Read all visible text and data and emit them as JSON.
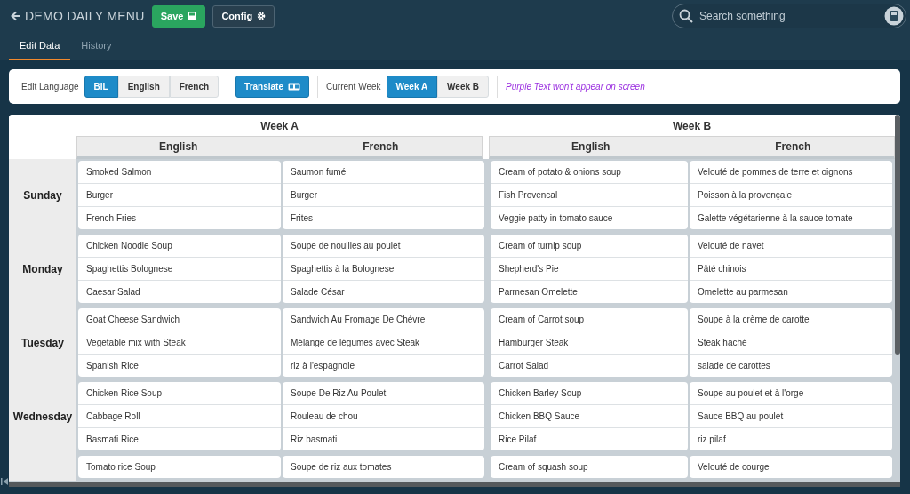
{
  "header": {
    "title": "DEMO DAILY MENU",
    "buttons": [
      {
        "label": "Save",
        "kind": "save"
      },
      {
        "label": "Config",
        "kind": "config"
      }
    ],
    "search": {
      "placeholder": "Search something"
    }
  },
  "tabs": [
    {
      "label": "Edit Data",
      "selected": true
    },
    {
      "label": "History",
      "selected": false
    }
  ],
  "toolbar": {
    "language_label": "Edit Language",
    "languages": [
      {
        "label": "BIL",
        "selected": true
      },
      {
        "label": "English",
        "selected": false
      },
      {
        "label": "French",
        "selected": false
      }
    ],
    "translate": "Translate",
    "week_label": "Current Week",
    "weeks": [
      {
        "label": "Week A",
        "selected": true
      },
      {
        "label": "Week B",
        "selected": false
      }
    ],
    "note": "Purple Text won't appear on screen"
  },
  "table": {
    "weeks": [
      {
        "title": "Week A",
        "columns": [
          "English",
          "French"
        ]
      },
      {
        "title": "Week B",
        "columns": [
          "English",
          "French"
        ]
      }
    ],
    "days": [
      {
        "day": "Sunday",
        "menus": [
          [
            "Smoked Salmon",
            "Burger",
            "French Fries"
          ],
          [
            "Saumon fumé",
            "Burger",
            "Frites"
          ],
          [
            "Cream of potato & onions soup",
            "Fish Provencal",
            "Veggie patty in tomato sauce"
          ],
          [
            "Velouté de pommes de terre et oignons",
            "Poisson à la provençale",
            "Galette végétarienne à la sauce tomate"
          ]
        ]
      },
      {
        "day": "Monday",
        "menus": [
          [
            "Chicken Noodle Soup",
            "Spaghettis Bolognese",
            "Caesar Salad"
          ],
          [
            "Soupe de nouilles au poulet",
            "Spaghettis à la Bolognese",
            "Salade César"
          ],
          [
            "Cream of turnip soup",
            "Shepherd's Pie",
            "Parmesan Omelette"
          ],
          [
            "Velouté de navet",
            "Pâté chinois",
            "Omelette au parmesan"
          ]
        ]
      },
      {
        "day": "Tuesday",
        "menus": [
          [
            "Goat Cheese Sandwich",
            "Vegetable mix with Steak",
            "Spanish Rice"
          ],
          [
            "Sandwich Au Fromage De Chévre",
            "Mélange de légumes avec Steak",
            "riz à l'espagnole"
          ],
          [
            "Cream of Carrot soup",
            "Hamburger Steak",
            "Carrot Salad"
          ],
          [
            "Soupe à la crème de carotte",
            "Steak haché",
            "salade de carottes"
          ]
        ]
      },
      {
        "day": "Wednesday",
        "menus": [
          [
            "Chicken Rice Soup",
            "Cabbage Roll",
            "Basmati Rice"
          ],
          [
            "Soupe De Riz Au Poulet",
            "Rouleau de chou",
            "Riz basmati"
          ],
          [
            "Chicken Barley Soup",
            "Chicken BBQ Sauce",
            "Rice Pilaf"
          ],
          [
            "Soupe au poulet et à l'orge",
            "Sauce BBQ au poulet",
            "riz pilaf"
          ]
        ]
      },
      {
        "menus": [
          [
            "Tomato rice Soup"
          ],
          [
            "Soupe de riz aux tomates"
          ],
          [
            "Cream of squash soup"
          ],
          [
            "Velouté de courge"
          ]
        ]
      }
    ]
  }
}
